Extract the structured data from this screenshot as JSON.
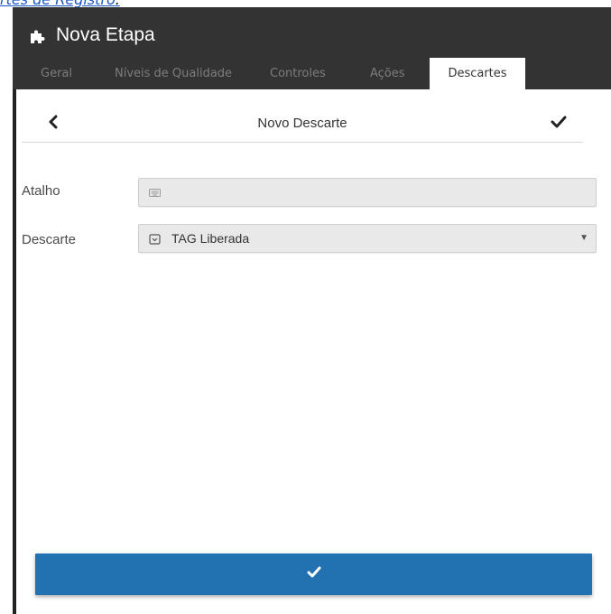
{
  "top_link": {
    "text": "rtes de Registro",
    "suffix": "."
  },
  "window": {
    "title": "Nova Etapa",
    "title_icon": "puzzle-icon"
  },
  "tabs": [
    {
      "label": "Geral",
      "active": false
    },
    {
      "label": "Níveis de Qualidade",
      "active": false
    },
    {
      "label": "Controles",
      "active": false
    },
    {
      "label": "Ações",
      "active": false
    },
    {
      "label": "Descartes",
      "active": true
    }
  ],
  "subheader": {
    "title": "Novo Descarte",
    "back_icon": "chevron-left-icon",
    "confirm_icon": "check-icon"
  },
  "form": {
    "atalho": {
      "label": "Atalho",
      "value": "",
      "placeholder": "",
      "icon": "keyboard-icon"
    },
    "descarte": {
      "label": "Descarte",
      "value": "TAG Liberada",
      "icon": "list-box-icon",
      "caret": "▼"
    }
  },
  "footer": {
    "confirm_icon": "check-icon"
  },
  "colors": {
    "header_bg": "#333333",
    "tab_inactive": "#7d7d7d",
    "accent_blue": "#2271b1",
    "field_bg": "#e9e9e9",
    "link": "#1a56c4"
  }
}
